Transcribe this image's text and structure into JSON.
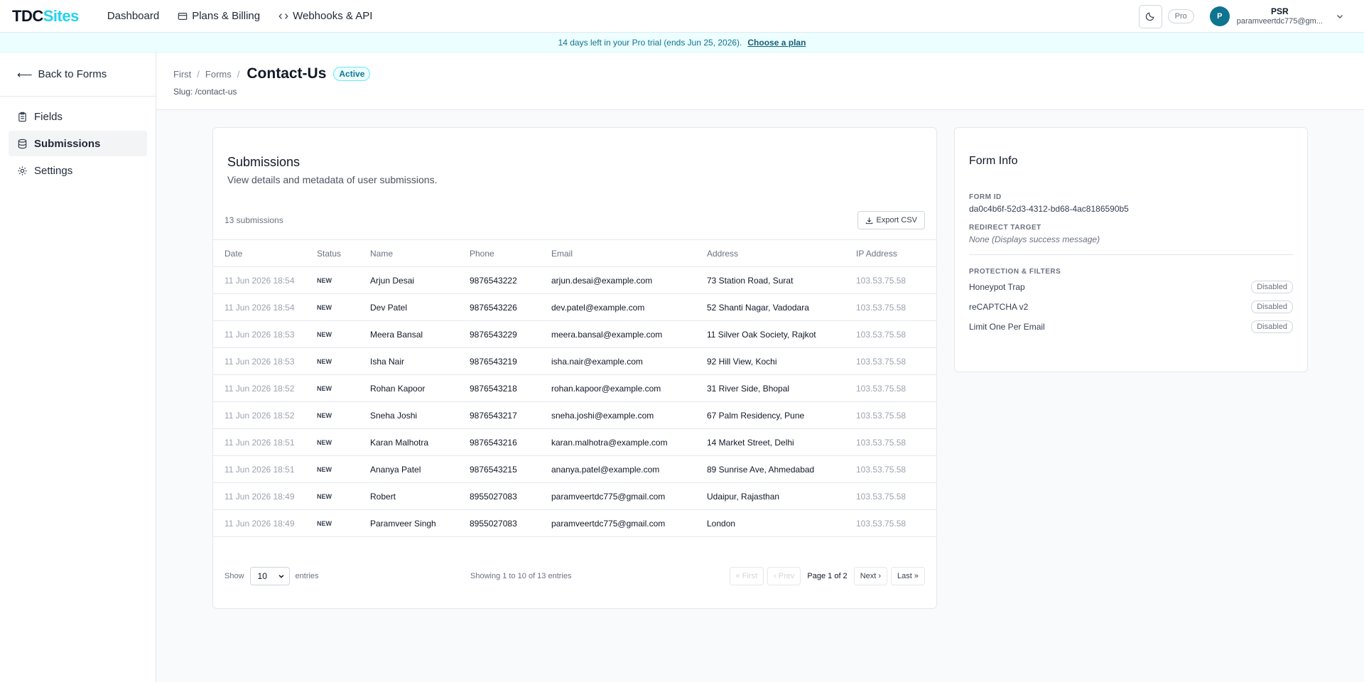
{
  "nav": {
    "logo_a": "TDC",
    "logo_b": "Sites",
    "links": [
      "Dashboard",
      "Plans & Billing",
      "Webhooks & API"
    ],
    "pro_badge": "Pro",
    "user_initial": "P",
    "user_name": "PSR",
    "user_email": "paramveertdc775@gm..."
  },
  "banner": {
    "text": "14 days left in your Pro trial (ends Jun 25, 2026).",
    "link": "Choose a plan"
  },
  "sidebar": {
    "back": "Back to Forms",
    "items": [
      {
        "label": "Fields",
        "icon": "clipboard-icon"
      },
      {
        "label": "Submissions",
        "icon": "database-icon"
      },
      {
        "label": "Settings",
        "icon": "gear-icon"
      }
    ]
  },
  "header": {
    "crumbs": [
      "First",
      "Forms"
    ],
    "title": "Contact-Us",
    "status": "Active",
    "slug": "Slug: /contact-us"
  },
  "submissions": {
    "title": "Submissions",
    "description": "View details and metadata of user submissions.",
    "count": "13 submissions",
    "export_label": "Export CSV",
    "columns": [
      "Date",
      "Status",
      "Name",
      "Phone",
      "Email",
      "Address",
      "IP Address"
    ],
    "rows": [
      [
        "11 Jun 2026 18:54",
        "NEW",
        "Arjun Desai",
        "9876543222",
        "arjun.desai@example.com",
        "73 Station Road, Surat",
        "103.53.75.58"
      ],
      [
        "11 Jun 2026 18:54",
        "NEW",
        "Dev Patel",
        "9876543226",
        "dev.patel@example.com",
        "52 Shanti Nagar, Vadodara",
        "103.53.75.58"
      ],
      [
        "11 Jun 2026 18:53",
        "NEW",
        "Meera Bansal",
        "9876543229",
        "meera.bansal@example.com",
        "11 Silver Oak Society, Rajkot",
        "103.53.75.58"
      ],
      [
        "11 Jun 2026 18:53",
        "NEW",
        "Isha Nair",
        "9876543219",
        "isha.nair@example.com",
        "92 Hill View, Kochi",
        "103.53.75.58"
      ],
      [
        "11 Jun 2026 18:52",
        "NEW",
        "Rohan Kapoor",
        "9876543218",
        "rohan.kapoor@example.com",
        "31 River Side, Bhopal",
        "103.53.75.58"
      ],
      [
        "11 Jun 2026 18:52",
        "NEW",
        "Sneha Joshi",
        "9876543217",
        "sneha.joshi@example.com",
        "67 Palm Residency, Pune",
        "103.53.75.58"
      ],
      [
        "11 Jun 2026 18:51",
        "NEW",
        "Karan Malhotra",
        "9876543216",
        "karan.malhotra@example.com",
        "14 Market Street, Delhi",
        "103.53.75.58"
      ],
      [
        "11 Jun 2026 18:51",
        "NEW",
        "Ananya Patel",
        "9876543215",
        "ananya.patel@example.com",
        "89 Sunrise Ave, Ahmedabad",
        "103.53.75.58"
      ],
      [
        "11 Jun 2026 18:49",
        "NEW",
        "Robert",
        "8955027083",
        "paramveertdc775@gmail.com",
        "Udaipur, Rajasthan",
        "103.53.75.58"
      ],
      [
        "11 Jun 2026 18:49",
        "NEW",
        "Paramveer Singh",
        "8955027083",
        "paramveertdc775@gmail.com",
        "London",
        "103.53.75.58"
      ]
    ],
    "show_label": "Show",
    "page_size": "10",
    "entries_label": "entries",
    "showing": "Showing 1 to 10 of 13 entries",
    "first": "« First",
    "prev": "‹ Prev",
    "page": "Page 1 of 2",
    "next": "Next ›",
    "last": "Last »"
  },
  "form_info": {
    "title": "Form Info",
    "form_id_label": "FORM ID",
    "form_id": "da0c4b6f-52d3-4312-bd68-4ac8186590b5",
    "redirect_label": "REDIRECT TARGET",
    "redirect": "None (Displays success message)",
    "filters_label": "PROTECTION & FILTERS",
    "filters": [
      {
        "name": "Honeypot Trap",
        "state": "Disabled"
      },
      {
        "name": "reCAPTCHA v2",
        "state": "Disabled"
      },
      {
        "name": "Limit One Per Email",
        "state": "Disabled"
      }
    ]
  }
}
